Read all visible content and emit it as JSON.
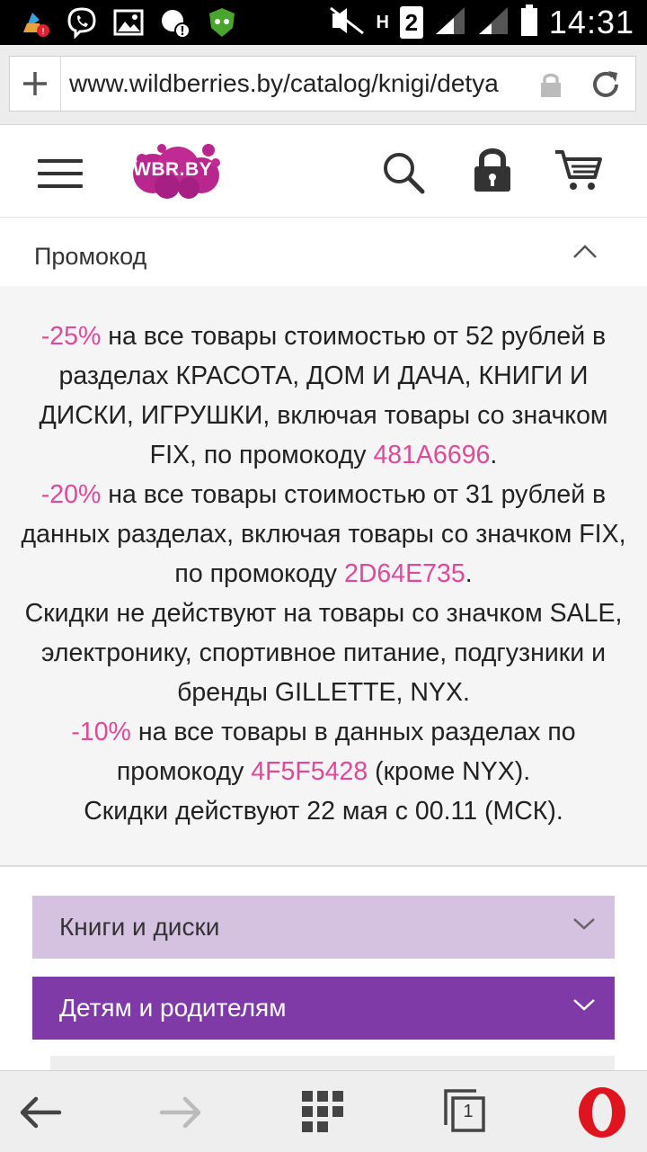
{
  "status_bar": {
    "time": "14:31",
    "network_h": "H",
    "sim_badge": "2",
    "icons": [
      "notification-icon",
      "viber-icon",
      "image-icon",
      "alert-icon",
      "antivirus-icon",
      "mute-icon",
      "signal-icon",
      "battery-icon"
    ]
  },
  "browser": {
    "url": "www.wildberries.by/catalog/knigi/detya",
    "tabs_count": "1"
  },
  "site_header": {
    "logo_text": "WBR.BY",
    "brand_color": "#b8268e"
  },
  "promo": {
    "title": "Промокод",
    "accent_color": "#e0489a",
    "p1_discount": "-25%",
    "p1_text": " на все товары стоимостью от 52 рублей в разделах КРАСОТА, ДОМ И ДАЧА, КНИГИ И ДИСКИ, ИГРУШКИ, включая товары со значком FIX, по промокоду ",
    "p1_code": "481A6696",
    "p1_end": ".",
    "p2_discount": "-20%",
    "p2_text": " на все товары стоимостью от 31 рублей в данных разделах, включая товары со значком FIX, по промокоду ",
    "p2_code": "2D64E735",
    "p2_end": ".",
    "p3_text": "Скидки не действуют на товары со значком SALE, электронику, спортивное питание, подгузники и бренды GILLETTE, NYX.",
    "p4_discount": "-10%",
    "p4_text": " на все товары в данных разделах по промокоду ",
    "p4_code": "4F5F5428",
    "p4_end": " (кроме NYX).",
    "p5_text": "Скидки действуют 22 мая с 00.11 (МСК)."
  },
  "categories": [
    {
      "label": "Книги и диски",
      "color": "#d4c2e0"
    },
    {
      "label": "Детям и родителям",
      "color": "#7f3aa7"
    }
  ]
}
